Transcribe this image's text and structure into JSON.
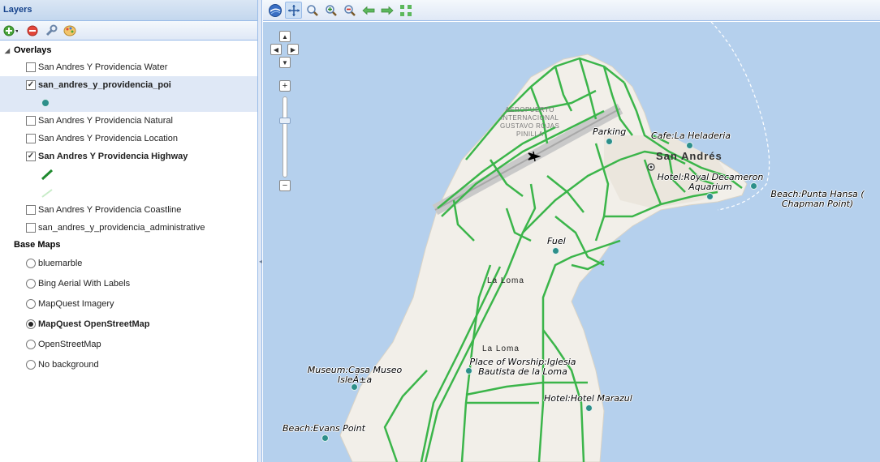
{
  "panel": {
    "title": "Layers",
    "toolbar_icons": [
      "add-layer-icon",
      "remove-layer-icon",
      "layer-properties-icon",
      "style-icon"
    ]
  },
  "overlays": {
    "label": "Overlays",
    "layers": [
      {
        "name": "San Andres Y Providencia Water",
        "checked": false
      },
      {
        "name": "san_andres_y_providencia_poi",
        "checked": true
      },
      {
        "name": "San Andres Y Providencia Natural",
        "checked": false
      },
      {
        "name": "San Andres Y Providencia Location",
        "checked": false
      },
      {
        "name": "San Andres Y Providencia Highway",
        "checked": true
      },
      {
        "name": "San Andres Y Providencia Coastline",
        "checked": false
      },
      {
        "name": "san_andres_y_providencia_administrative",
        "checked": false
      }
    ]
  },
  "basemaps": {
    "label": "Base Maps",
    "items": [
      {
        "name": "bluemarble",
        "selected": false
      },
      {
        "name": "Bing Aerial With Labels",
        "selected": false
      },
      {
        "name": "MapQuest Imagery",
        "selected": false
      },
      {
        "name": "MapQuest OpenStreetMap",
        "selected": true
      },
      {
        "name": "OpenStreetMap",
        "selected": false
      },
      {
        "name": "No background",
        "selected": false
      }
    ]
  },
  "map_toolbar": {
    "icons": [
      "globe-icon",
      "pan-icon",
      "zoom-in-box-icon",
      "zoom-in-icon",
      "zoom-out-icon",
      "back-arrow-icon",
      "forward-arrow-icon",
      "zoom-extent-icon"
    ]
  },
  "map": {
    "town_label": "San Andrés",
    "airport_label": [
      "AEROPUERTO",
      "INTERNACIONAL",
      "GUSTAVO ROJAS",
      "PINILLA"
    ],
    "place_label": "La Loma",
    "place_label_2": "La Loma",
    "pois": [
      {
        "label": "Parking"
      },
      {
        "label": "Cafe:La Heladeria"
      },
      {
        "label": "Hotel:Royal Decameron Aquarium"
      },
      {
        "label": "Beach:Punta Hansa ( Chapman Point)"
      },
      {
        "label": "Fuel"
      },
      {
        "label": "Place of Worship:Iglesia Bautista de la Loma"
      },
      {
        "label": "Museum:Casa Museo IsleÃ±a"
      },
      {
        "label": "Hotel:Hotel Marazul"
      },
      {
        "label": "Beach:Evans Point"
      }
    ],
    "colors": {
      "water": "#b5d0ed",
      "land": "#f2efe9",
      "highway": "#3bb54a",
      "poi": "#2d8f8a"
    }
  }
}
